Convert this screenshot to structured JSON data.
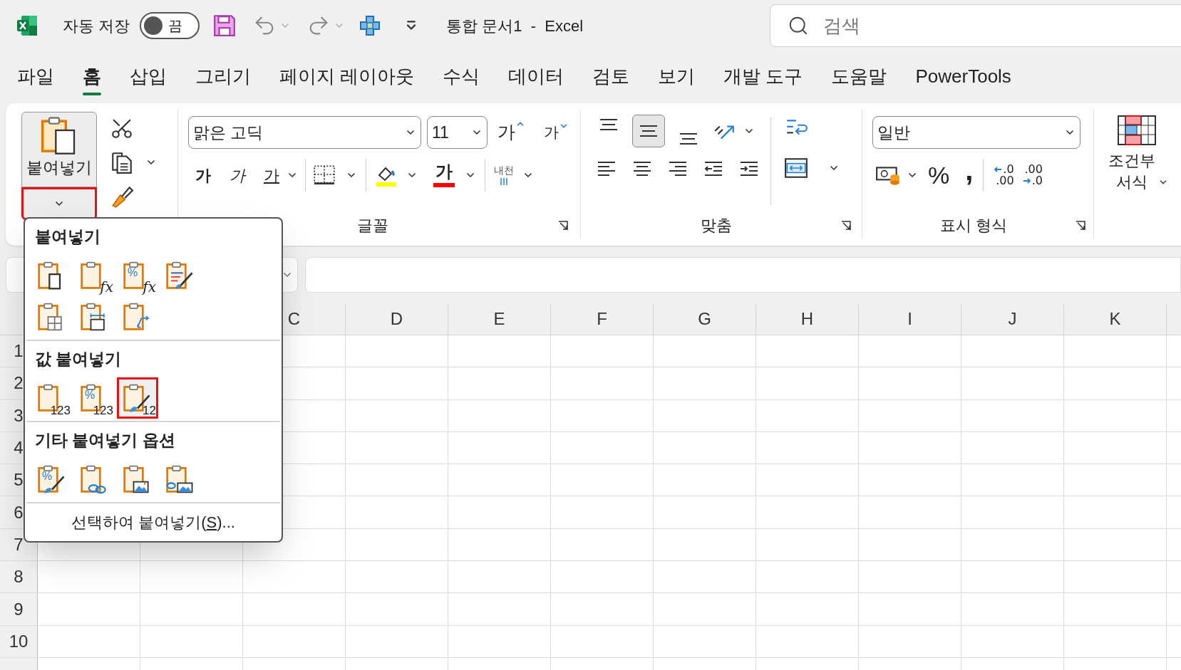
{
  "title_bar": {
    "autosave": {
      "label": "자동 저장",
      "on": false,
      "state_label": "끔"
    },
    "document_title": "통합 문서1  -  Excel",
    "search": {
      "placeholder": "검색"
    }
  },
  "ribbon_tabs": [
    {
      "label": "파일",
      "selected": false
    },
    {
      "label": "홈",
      "selected": true
    },
    {
      "label": "삽입",
      "selected": false
    },
    {
      "label": "그리기",
      "selected": false
    },
    {
      "label": "페이지 레이아웃",
      "selected": false
    },
    {
      "label": "수식",
      "selected": false
    },
    {
      "label": "데이터",
      "selected": false
    },
    {
      "label": "검토",
      "selected": false
    },
    {
      "label": "보기",
      "selected": false
    },
    {
      "label": "개발 도구",
      "selected": false
    },
    {
      "label": "도움말",
      "selected": false
    },
    {
      "label": "PowerTools",
      "selected": false
    }
  ],
  "clipboard": {
    "paste_label": "붙여넣기",
    "arrow_highlighted": true
  },
  "font": {
    "label": "글꼴",
    "name": "맑은 고딕",
    "size": "11",
    "grow": "가",
    "shrink": "가",
    "bold": "가",
    "italic": "가",
    "underline": "가",
    "font_color": "가",
    "phonetic": "내천"
  },
  "alignment": {
    "label": "맞춤",
    "vertical": [
      {
        "kind": "top",
        "selected": false
      },
      {
        "kind": "middle",
        "selected": true
      },
      {
        "kind": "bottom",
        "selected": false
      }
    ]
  },
  "number": {
    "label": "표시 형식",
    "format": "일반",
    "percent": "%",
    "comma": ",",
    "decimals": [
      {
        "kind": "increase",
        "top": ".0",
        "bottom": ".00"
      },
      {
        "kind": "decrease",
        "top": ".00",
        "bottom": ".0"
      }
    ]
  },
  "conditional_format": {
    "label": "조건부 서식"
  },
  "sheet": {
    "columns": [
      "C",
      "D",
      "E",
      "F",
      "G",
      "H",
      "I",
      "J",
      "K"
    ],
    "rows": [
      "1",
      "2",
      "3",
      "4",
      "5",
      "6",
      "7",
      "8",
      "9",
      "10"
    ]
  },
  "paste_menu": {
    "sections": [
      {
        "title": "붙여넣기",
        "options": [
          {
            "kind": "all",
            "highlighted": false
          },
          {
            "kind": "formulas",
            "glyph": "fx",
            "highlighted": false
          },
          {
            "kind": "formulas",
            "mark": "%",
            "glyph": "fx",
            "highlighted": false
          },
          {
            "kind": "source",
            "highlighted": false
          },
          {
            "kind": "no-border",
            "highlighted": false
          },
          {
            "kind": "width",
            "highlighted": false
          },
          {
            "kind": "transpose",
            "highlighted": false
          }
        ]
      },
      {
        "title": "값 붙여넣기",
        "options": [
          {
            "kind": "values",
            "glyph": "123",
            "highlighted": false
          },
          {
            "kind": "values",
            "mark": "%",
            "glyph": "123",
            "highlighted": false
          },
          {
            "kind": "values-source",
            "glyph": "12",
            "highlighted": true
          }
        ]
      },
      {
        "title": "기타 붙여넣기 옵션",
        "options": [
          {
            "kind": "formatting",
            "mark": "%",
            "highlighted": false
          },
          {
            "kind": "link",
            "highlighted": false
          },
          {
            "kind": "picture",
            "highlighted": false
          },
          {
            "kind": "linked-picture",
            "highlighted": false
          }
        ]
      }
    ],
    "footer": {
      "prefix": "선택하여 붙여넣기(",
      "access_key": "S",
      "suffix": ")..."
    }
  }
}
